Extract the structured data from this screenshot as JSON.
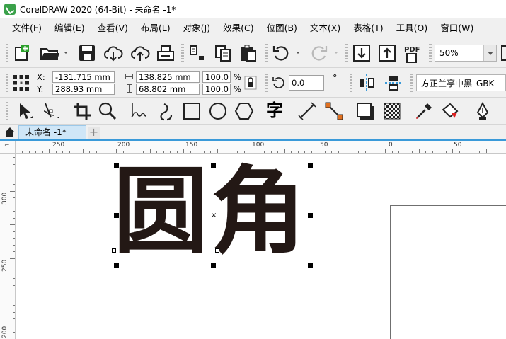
{
  "window": {
    "title": "CorelDRAW 2020 (64-Bit) - 未命名 -1*"
  },
  "menu": [
    "文件(F)",
    "编辑(E)",
    "查看(V)",
    "布局(L)",
    "对象(J)",
    "效果(C)",
    "位图(B)",
    "文本(X)",
    "表格(T)",
    "工具(O)",
    "窗口(W)"
  ],
  "standard_toolbar": {
    "pdf_label": "PDF",
    "zoom": "50%"
  },
  "property_bar": {
    "x_label": "X:",
    "y_label": "Y:",
    "x_value": "-131.715 mm",
    "y_value": "288.93 mm",
    "width_value": "138.825 mm",
    "height_value": "68.802 mm",
    "scale_x": "100.0",
    "scale_y": "100.0",
    "percent_sign": "%",
    "angle_value": "0.0",
    "degree_sign": "°",
    "font_name": "方正兰亭中黑_GBK"
  },
  "toolbox": {
    "text_tool_glyph": "字"
  },
  "document_tab": {
    "label": "未命名 -1*",
    "add_label": "+"
  },
  "ruler": {
    "horizontal_labels": [
      "250",
      "200",
      "150",
      "100",
      "50",
      "0",
      "50"
    ],
    "vertical_labels": [
      "300",
      "250",
      "200"
    ]
  },
  "canvas": {
    "art_text": "圆角",
    "text_color": "#231815",
    "center_marker": "×"
  },
  "colors": {
    "accent": "#3a9ad9",
    "tab_bg": "#cfe6f7",
    "logo_green": "#3aa14a"
  }
}
